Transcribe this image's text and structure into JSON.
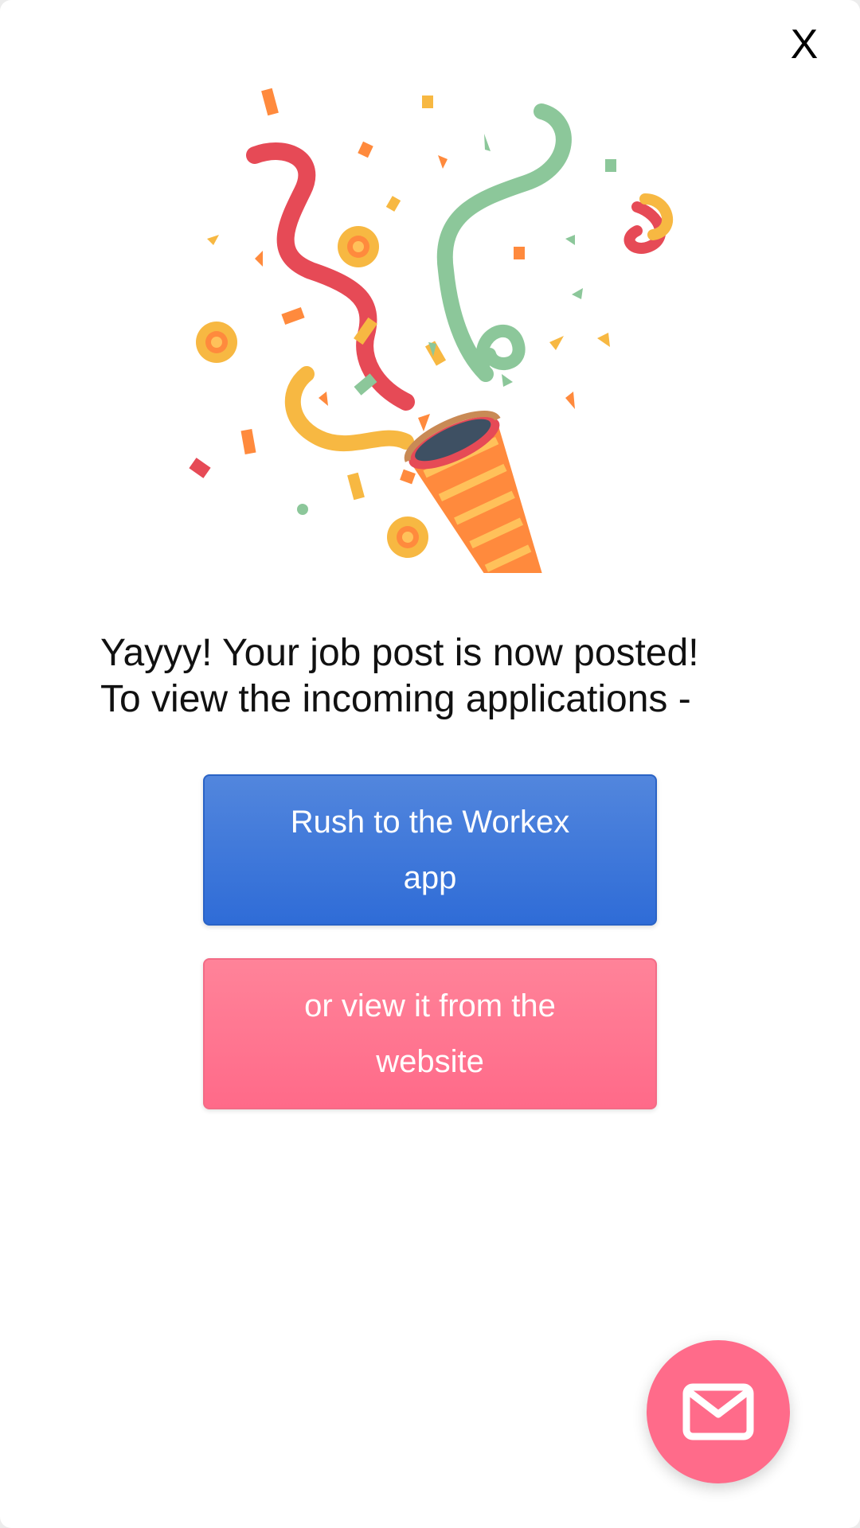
{
  "dialog": {
    "close_label": "X"
  },
  "message": {
    "line1": "Yayyy! Your job post is now posted!",
    "line2": "To view the incoming applications -"
  },
  "buttons": {
    "app_label": "Rush to the Workex app",
    "website_label": "or view it from the website"
  },
  "icons": {
    "illustration": "party-popper-icon",
    "fab": "mail-icon"
  },
  "colors": {
    "primary_blue": "#3a72d9",
    "primary_pink": "#ff6f8c",
    "fab_pink": "#ff6b8a"
  }
}
